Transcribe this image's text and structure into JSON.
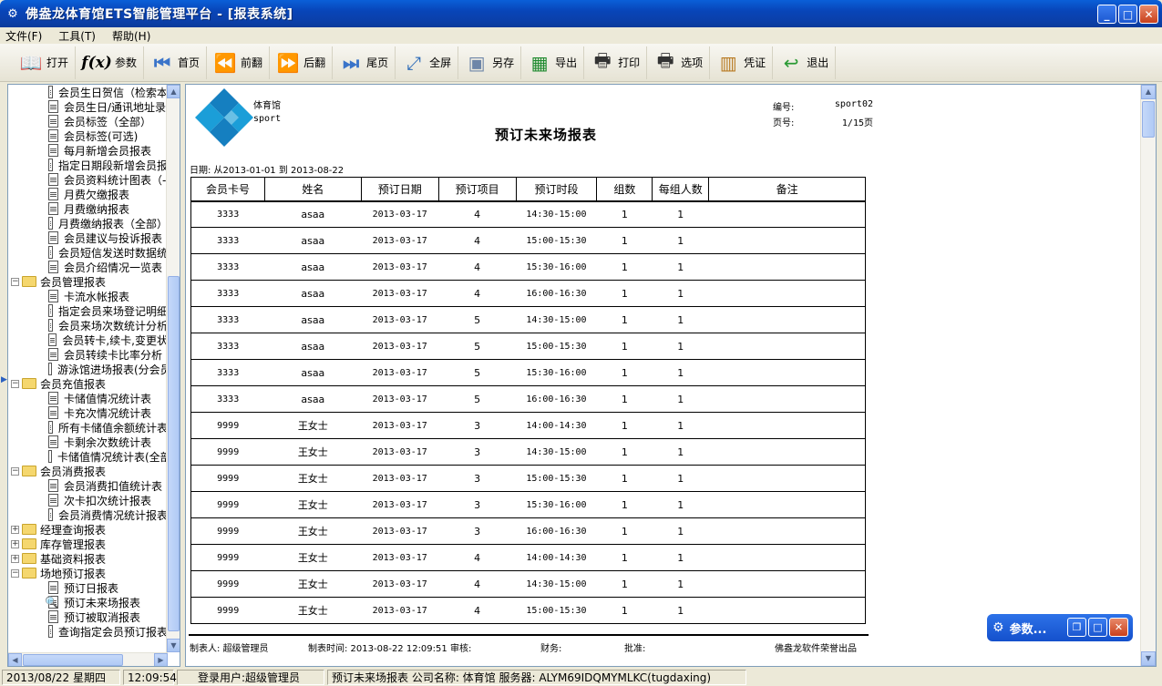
{
  "window": {
    "title": "佛盎龙体育馆ETS智能管理平台 - [报表系统]"
  },
  "menu": [
    "文件(F)",
    "工具(T)",
    "帮助(H)"
  ],
  "toolbar": {
    "open": "打开",
    "params": "参数",
    "first": "首页",
    "prev": "前翻",
    "next": "后翻",
    "last": "尾页",
    "fullscreen": "全屏",
    "saveas": "另存",
    "export": "导出",
    "print": "打印",
    "options": "选项",
    "voucher": "凭证",
    "exit": "退出"
  },
  "tree": [
    {
      "type": "leaf",
      "label": "会员生日贺信（检索本"
    },
    {
      "type": "leaf",
      "label": "会员生日/通讯地址录"
    },
    {
      "type": "leaf",
      "label": "会员标签（全部）"
    },
    {
      "type": "leaf",
      "label": "会员标签(可选)"
    },
    {
      "type": "leaf",
      "label": "每月新增会员报表"
    },
    {
      "type": "leaf",
      "label": "指定日期段新增会员报"
    },
    {
      "type": "leaf",
      "label": "会员资料统计图表（-"
    },
    {
      "type": "leaf",
      "label": "月费欠缴报表"
    },
    {
      "type": "leaf",
      "label": "月费缴纳报表"
    },
    {
      "type": "leaf",
      "label": "月费缴纳报表（全部）"
    },
    {
      "type": "leaf",
      "label": "会员建议与投诉报表"
    },
    {
      "type": "leaf",
      "label": "会员短信发送时数据统"
    },
    {
      "type": "leaf",
      "label": "会员介绍情况一览表"
    },
    {
      "type": "folder",
      "sign": "−",
      "label": "会员管理报表"
    },
    {
      "type": "leaf",
      "label": "卡流水帐报表"
    },
    {
      "type": "leaf",
      "label": "指定会员来场登记明细"
    },
    {
      "type": "leaf",
      "label": "会员来场次数统计分析"
    },
    {
      "type": "leaf",
      "label": "会员转卡,续卡,变更状"
    },
    {
      "type": "leaf",
      "label": "会员转续卡比率分析"
    },
    {
      "type": "leaf",
      "label": "游泳馆进场报表(分会员"
    },
    {
      "type": "folder",
      "sign": "−",
      "label": "会员充值报表"
    },
    {
      "type": "leaf",
      "label": "卡储值情况统计表"
    },
    {
      "type": "leaf",
      "label": "卡充次情况统计表"
    },
    {
      "type": "leaf",
      "label": "所有卡储值余额统计表"
    },
    {
      "type": "leaf",
      "label": "卡剩余次数统计表"
    },
    {
      "type": "leaf",
      "label": "卡储值情况统计表(全部"
    },
    {
      "type": "folder",
      "sign": "−",
      "label": "会员消费报表"
    },
    {
      "type": "leaf",
      "label": "会员消费扣值统计表"
    },
    {
      "type": "leaf",
      "label": "次卡扣次统计报表"
    },
    {
      "type": "leaf",
      "label": "会员消费情况统计报表"
    },
    {
      "type": "folder",
      "sign": "+",
      "label": "经理查询报表"
    },
    {
      "type": "folder",
      "sign": "+",
      "label": "库存管理报表"
    },
    {
      "type": "folder",
      "sign": "+",
      "label": "基础资料报表"
    },
    {
      "type": "folder",
      "sign": "−",
      "label": "场地预订报表"
    },
    {
      "type": "leaf",
      "label": "预订日报表"
    },
    {
      "type": "leaf",
      "label": "预订未来场报表",
      "active": true
    },
    {
      "type": "leaf",
      "label": "预订被取消报表"
    },
    {
      "type": "leaf",
      "label": "查询指定会员预订报表"
    }
  ],
  "report": {
    "company_name": "体育馆",
    "company_en": "sport",
    "title": "预订未来场报表",
    "number_label": "编号:",
    "number_value": "sport02",
    "page_label": "页号:",
    "page_value": "1/15页",
    "date_range": "日期: 从2013-01-01 到 2013-08-22",
    "columns": [
      "会员卡号",
      "姓名",
      "预订日期",
      "预订项目",
      "预订时段",
      "组数",
      "每组人数",
      "备注"
    ],
    "rows": [
      [
        "3333",
        "asaa",
        "2013-03-17",
        "4",
        "14:30-15:00",
        "1",
        "1",
        ""
      ],
      [
        "3333",
        "asaa",
        "2013-03-17",
        "4",
        "15:00-15:30",
        "1",
        "1",
        ""
      ],
      [
        "3333",
        "asaa",
        "2013-03-17",
        "4",
        "15:30-16:00",
        "1",
        "1",
        ""
      ],
      [
        "3333",
        "asaa",
        "2013-03-17",
        "4",
        "16:00-16:30",
        "1",
        "1",
        ""
      ],
      [
        "3333",
        "asaa",
        "2013-03-17",
        "5",
        "14:30-15:00",
        "1",
        "1",
        ""
      ],
      [
        "3333",
        "asaa",
        "2013-03-17",
        "5",
        "15:00-15:30",
        "1",
        "1",
        ""
      ],
      [
        "3333",
        "asaa",
        "2013-03-17",
        "5",
        "15:30-16:00",
        "1",
        "1",
        ""
      ],
      [
        "3333",
        "asaa",
        "2013-03-17",
        "5",
        "16:00-16:30",
        "1",
        "1",
        ""
      ],
      [
        "9999",
        "王女士",
        "2013-03-17",
        "3",
        "14:00-14:30",
        "1",
        "1",
        ""
      ],
      [
        "9999",
        "王女士",
        "2013-03-17",
        "3",
        "14:30-15:00",
        "1",
        "1",
        ""
      ],
      [
        "9999",
        "王女士",
        "2013-03-17",
        "3",
        "15:00-15:30",
        "1",
        "1",
        ""
      ],
      [
        "9999",
        "王女士",
        "2013-03-17",
        "3",
        "15:30-16:00",
        "1",
        "1",
        ""
      ],
      [
        "9999",
        "王女士",
        "2013-03-17",
        "3",
        "16:00-16:30",
        "1",
        "1",
        ""
      ],
      [
        "9999",
        "王女士",
        "2013-03-17",
        "4",
        "14:00-14:30",
        "1",
        "1",
        ""
      ],
      [
        "9999",
        "王女士",
        "2013-03-17",
        "4",
        "14:30-15:00",
        "1",
        "1",
        ""
      ],
      [
        "9999",
        "王女士",
        "2013-03-17",
        "4",
        "15:00-15:30",
        "1",
        "1",
        ""
      ]
    ],
    "footer": {
      "maker": "制表人: 超级管理员",
      "time": "制表时间: 2013-08-22 12:09:51",
      "reviewer": "审核:",
      "finance": "财务:",
      "approver": "批准:",
      "vendor": "佛盎龙软件荣誉出品"
    }
  },
  "param_panel": {
    "label": "参数..."
  },
  "status": {
    "date": "2013/08/22 星期四",
    "time": "12:09:54",
    "user": "登录用户:超级管理员",
    "info": "预订未来场报表 公司名称: 体育馆 服务器: ALYM69IDQMYMLKC(tugdaxing)"
  }
}
